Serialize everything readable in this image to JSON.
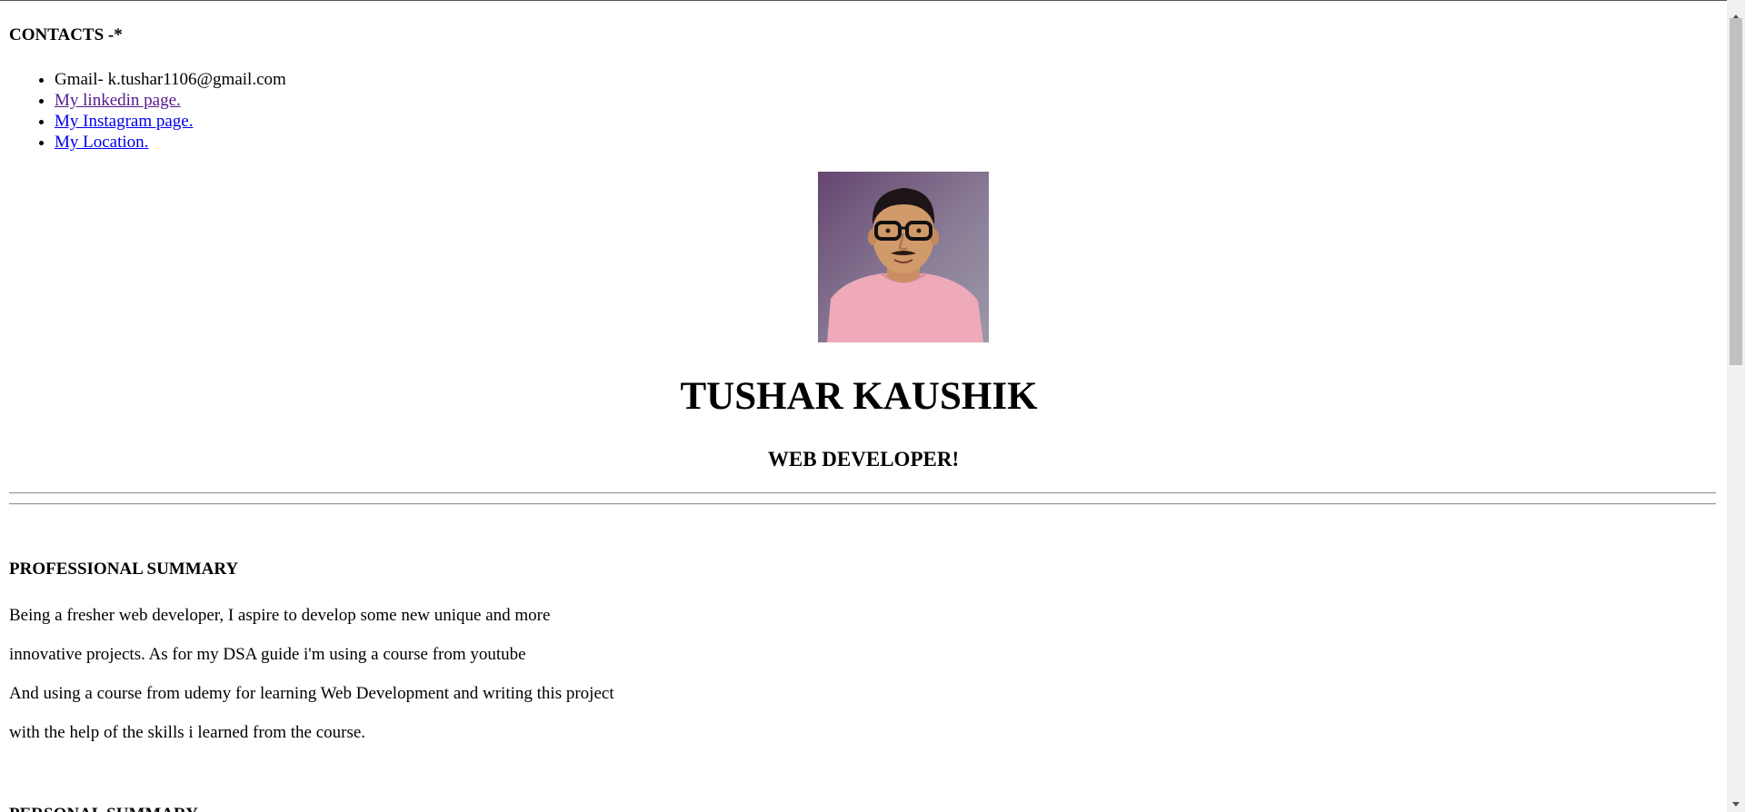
{
  "contacts": {
    "heading": "CONTACTS -*",
    "gmail_text": "Gmail- k.tushar1106@gmail.com",
    "linkedin_label": "My linkedin page.",
    "instagram_label": "My Instagram page.",
    "location_label": "My Location."
  },
  "profile": {
    "name": "TUSHAR KAUSHIK",
    "title": "WEB DEVELOPER!"
  },
  "professional_summary": {
    "heading": "PROFESSIONAL SUMMARY",
    "lines": [
      "Being a fresher web developer, I aspire to develop some new unique and more",
      "innovative projects. As for my DSA guide i'm using a course from youtube",
      "And using a course from udemy for learning Web Development and writing this project",
      "with the help of the skills i learned from the course."
    ]
  },
  "personal_summary": {
    "heading": "PERSONAL SUMMARY"
  },
  "colors": {
    "link": "#0000ee",
    "visited_link": "#551a8b",
    "scrollbar_track": "#f1f1f1",
    "scrollbar_thumb": "#c1c1c1"
  },
  "icons": {
    "scroll_up": "triangle-up-icon",
    "scroll_down": "triangle-down-icon"
  }
}
